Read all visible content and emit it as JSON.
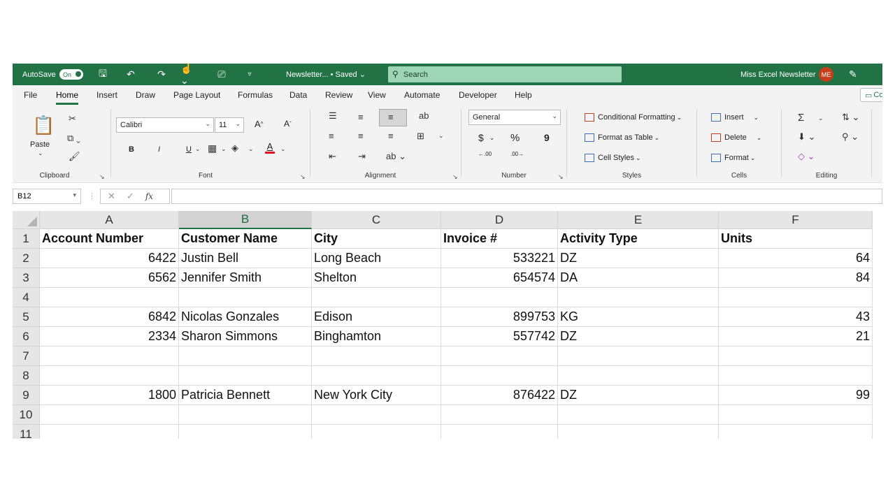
{
  "titlebar": {
    "autosave_label": "AutoSave",
    "autosave_state": "On",
    "doc_title": "Newsletter... • Saved ⌄",
    "search_placeholder": "Search",
    "user_name": "Miss Excel Newsletter",
    "user_initials": "ME"
  },
  "tabs": [
    "File",
    "Home",
    "Insert",
    "Draw",
    "Page Layout",
    "Formulas",
    "Data",
    "Review",
    "View",
    "Automate",
    "Developer",
    "Help"
  ],
  "active_tab": "Home",
  "comments_label": "Co",
  "ribbon": {
    "clipboard": {
      "paste_label": "Paste",
      "group_label": "Clipboard"
    },
    "font": {
      "font_name": "Calibri",
      "font_size": "11",
      "bold": "B",
      "italic": "I",
      "underline": "U",
      "font_color": "A",
      "grow": "A",
      "shrink": "A",
      "group_label": "Font"
    },
    "alignment": {
      "group_label": "Alignment"
    },
    "number": {
      "format": "General",
      "currency": "$",
      "percent": "%",
      "comma": "9",
      "inc_dec": ".00",
      "dec_dec": ".00",
      "group_label": "Number"
    },
    "styles": {
      "conditional": "Conditional Formatting",
      "format_table": "Format as Table",
      "cell_styles": "Cell Styles",
      "group_label": "Styles"
    },
    "cells": {
      "insert": "Insert",
      "delete": "Delete",
      "format": "Format",
      "group_label": "Cells"
    },
    "editing": {
      "group_label": "Editing"
    }
  },
  "formula_bar": {
    "name_box": "B12",
    "fx": "fx",
    "formula": ""
  },
  "columns": [
    "A",
    "B",
    "C",
    "D",
    "E",
    "F"
  ],
  "selected_column": "B",
  "rows": [
    {
      "n": "1",
      "cells": [
        "Account Number",
        "Customer Name",
        "City",
        "Invoice #",
        "Activity Type",
        "Units"
      ]
    },
    {
      "n": "2",
      "cells": [
        "6422",
        "Justin Bell",
        "Long Beach",
        "533221",
        "DZ",
        "64"
      ]
    },
    {
      "n": "3",
      "cells": [
        "6562",
        "Jennifer Smith",
        "Shelton",
        "654574",
        "DA",
        "84"
      ]
    },
    {
      "n": "4",
      "cells": [
        "",
        "",
        "",
        "",
        "",
        ""
      ]
    },
    {
      "n": "5",
      "cells": [
        "6842",
        "Nicolas Gonzales",
        "Edison",
        "899753",
        "KG",
        "43"
      ]
    },
    {
      "n": "6",
      "cells": [
        "2334",
        "Sharon Simmons",
        "Binghamton",
        "557742",
        "DZ",
        "21"
      ]
    },
    {
      "n": "7",
      "cells": [
        "",
        "",
        "",
        "",
        "",
        ""
      ]
    },
    {
      "n": "8",
      "cells": [
        "",
        "",
        "",
        "",
        "",
        ""
      ]
    },
    {
      "n": "9",
      "cells": [
        "1800",
        "Patricia Bennett",
        "New York City",
        "876422",
        "DZ",
        "99"
      ]
    },
    {
      "n": "10",
      "cells": [
        "",
        "",
        "",
        "",
        "",
        ""
      ]
    },
    {
      "n": "11",
      "cells": [
        "",
        "",
        "",
        "",
        "",
        ""
      ]
    }
  ]
}
